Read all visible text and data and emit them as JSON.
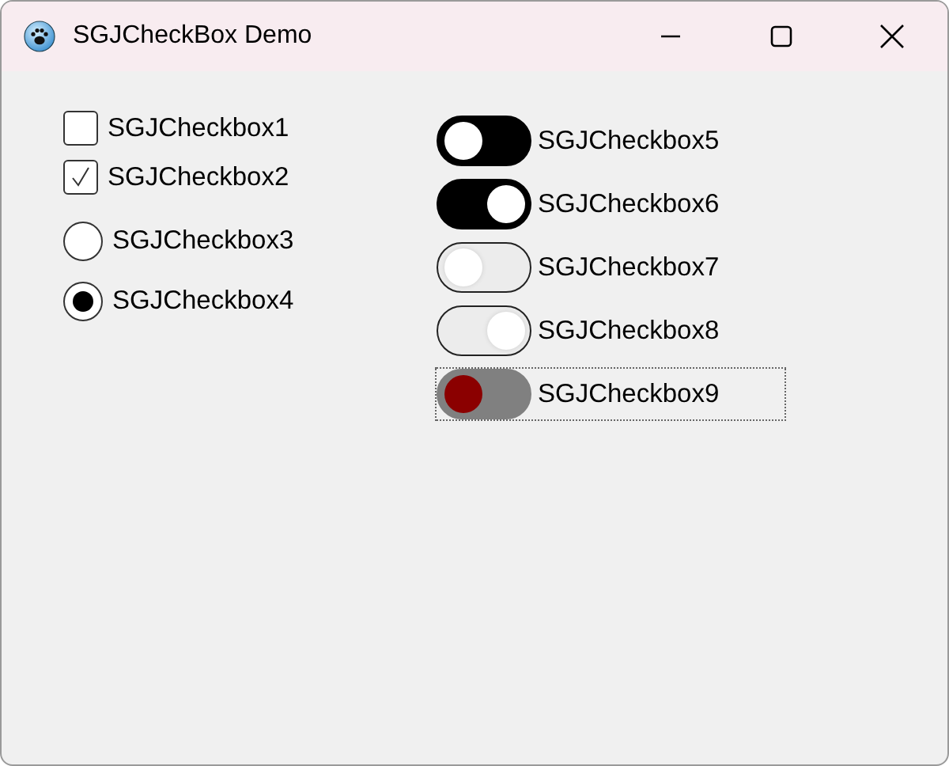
{
  "window": {
    "title": "SGJCheckBox Demo"
  },
  "checkboxes": [
    {
      "kind": "checkbox",
      "label": "SGJCheckbox1",
      "checked": false
    },
    {
      "kind": "checkbox",
      "label": "SGJCheckbox2",
      "checked": true
    },
    {
      "kind": "radio",
      "label": "SGJCheckbox3",
      "checked": false
    },
    {
      "kind": "radio",
      "label": "SGJCheckbox4",
      "checked": true
    }
  ],
  "toggles": [
    {
      "kind": "solid",
      "label": "SGJCheckbox5",
      "on": false,
      "focused": false
    },
    {
      "kind": "solid",
      "label": "SGJCheckbox6",
      "on": true,
      "focused": false
    },
    {
      "kind": "outline",
      "label": "SGJCheckbox7",
      "on": false,
      "focused": false
    },
    {
      "kind": "outline",
      "label": "SGJCheckbox8",
      "on": true,
      "focused": false
    },
    {
      "kind": "grey",
      "label": "SGJCheckbox9",
      "on": false,
      "focused": true,
      "color": "#8b0000"
    }
  ]
}
